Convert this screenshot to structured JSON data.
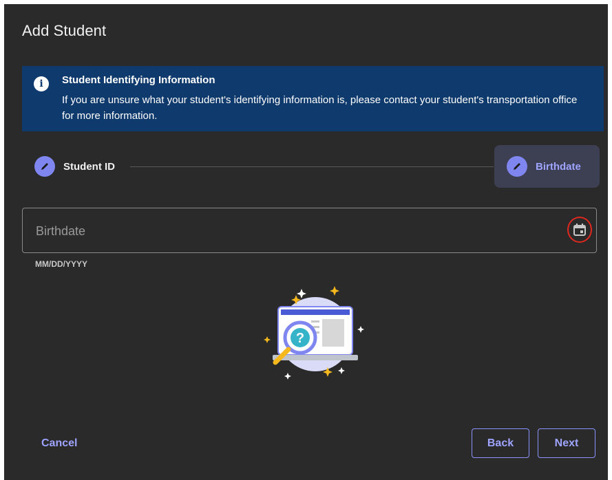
{
  "dialog": {
    "title": "Add Student"
  },
  "banner": {
    "title": "Student Identifying Information",
    "message": "If you are unsure what your student's identifying information is, please contact your student's transportation office for more information."
  },
  "stepper": {
    "steps": [
      {
        "label": "Student ID",
        "active": false
      },
      {
        "label": "Birthdate",
        "active": true
      }
    ]
  },
  "birthdate_field": {
    "placeholder": "Birthdate",
    "value": "",
    "hint": "MM/DD/YYYY"
  },
  "actions": {
    "cancel_label": "Cancel",
    "back_label": "Back",
    "next_label": "Next"
  },
  "icons": {
    "banner": "info-icon",
    "step": "pencil-icon",
    "field": "calendar-icon",
    "illustration": "laptop-magnifier-question-illustration"
  },
  "colors": {
    "dialog_bg": "#2a2a2a",
    "banner_bg": "#0f3a6e",
    "accent": "#9ea4ff",
    "step_circle": "#7f86f0",
    "highlight_ring": "#e0281f"
  }
}
